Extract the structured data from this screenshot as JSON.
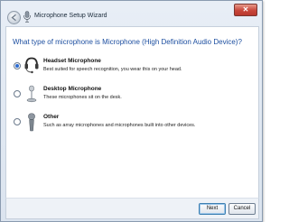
{
  "window": {
    "title": "Microphone Setup Wizard",
    "close_label": "✕"
  },
  "question": "What type of microphone is Microphone (High Definition Audio Device)?",
  "options": [
    {
      "title": "Headset Microphone",
      "description": "Best suited for speech recognition, you wear this on your head.",
      "selected": true,
      "icon": "headset-icon"
    },
    {
      "title": "Desktop Microphone",
      "description": "These microphones sit on the desk.",
      "selected": false,
      "icon": "desktop-microphone-icon"
    },
    {
      "title": "Other",
      "description": "Such as array microphones and microphones built into other devices.",
      "selected": false,
      "icon": "handheld-microphone-icon"
    }
  ],
  "buttons": {
    "next": "Next",
    "cancel": "Cancel"
  },
  "colors": {
    "accent": "#1d4fa0",
    "close": "#c8463a"
  }
}
